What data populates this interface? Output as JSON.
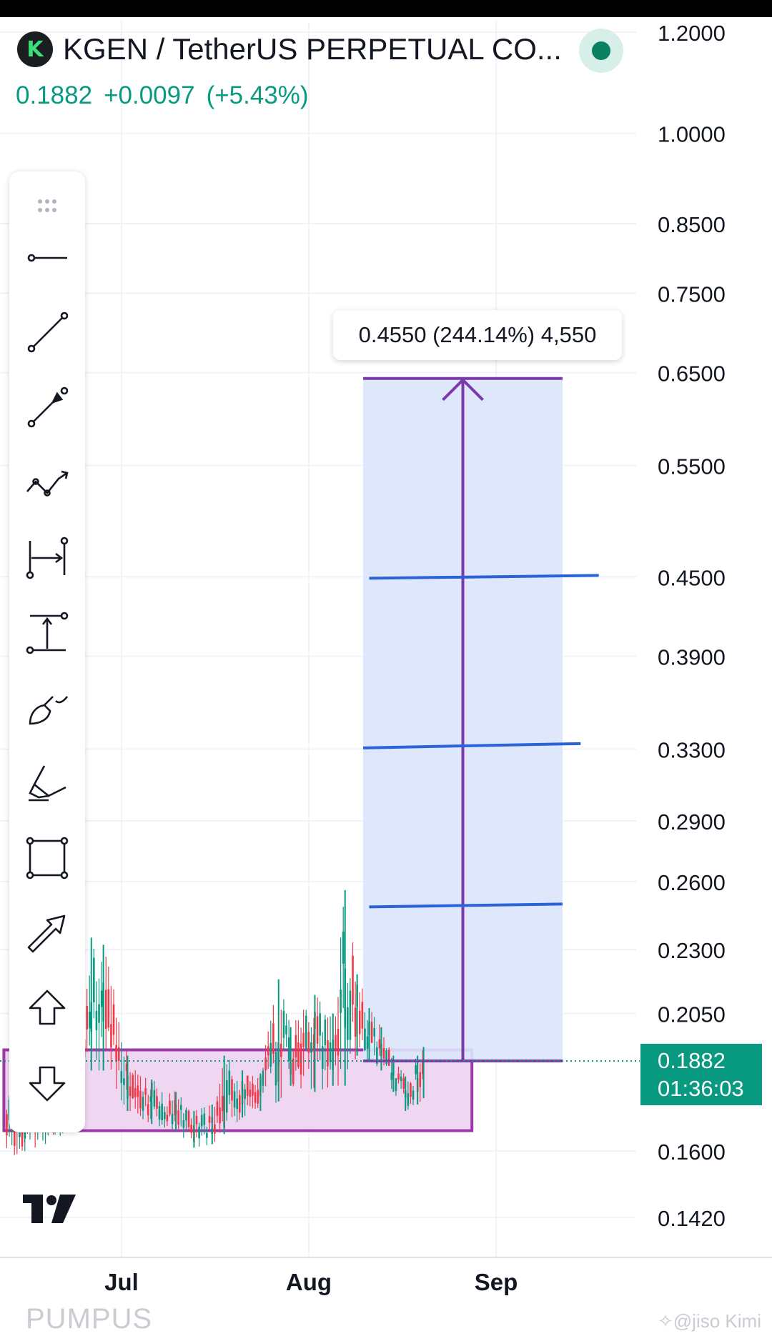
{
  "header": {
    "symbol_title": "KGEN / TetherUS PERPETUAL CO...",
    "logo_letter": "K",
    "last_price": "0.1882",
    "change": "+0.0097",
    "change_pct": "(+5.43%)"
  },
  "toolbar": {
    "tools": [
      "drag-handle-icon",
      "horizontal-ray-icon",
      "trend-line-icon",
      "arrow-line-icon",
      "path-icon",
      "date-range-icon",
      "price-range-icon",
      "brush-icon",
      "highlighter-icon",
      "rectangle-icon",
      "arrow-icon",
      "arrow-mark-up-icon",
      "arrow-mark-down-icon"
    ]
  },
  "measure": {
    "label": "0.4550 (244.14%) 4,550",
    "from_price": 0.1882,
    "to_price": 0.6432
  },
  "price_badge": {
    "price": "0.1882",
    "countdown": "01:36:03"
  },
  "footer": {
    "watermark": "PUMPUS",
    "credit": "✧@jiso Kimi"
  },
  "colors": {
    "up": "#089981",
    "down": "#f23645",
    "measure_fill": "#dbe6fb",
    "measure_line": "#7a3aa7",
    "box_fill": "#edd0ee",
    "box_stroke": "#9c3aa8",
    "hline": "#2a62d8"
  },
  "chart_data": {
    "type": "candlestick",
    "y_scale": "log",
    "y_ticks": [
      0.142,
      0.16,
      0.205,
      0.23,
      0.26,
      0.29,
      0.33,
      0.39,
      0.45,
      0.55,
      0.65,
      0.75,
      0.85,
      1.0,
      1.2
    ],
    "y_tick_labels": [
      "0.1420",
      "0.1600",
      "0.2050",
      "0.2300",
      "0.2600",
      "0.2900",
      "0.3300",
      "0.3900",
      "0.4500",
      "0.5500",
      "0.6500",
      "0.7500",
      "0.8500",
      "1.0000",
      "1.2000"
    ],
    "x_ticks": [
      {
        "label": "Jul",
        "date": "2025-07-01"
      },
      {
        "label": "Aug",
        "date": "2025-08-01"
      },
      {
        "label": "Sep",
        "date": "2025-09-01"
      }
    ],
    "x_range": [
      "2025-06-12",
      "2025-09-24"
    ],
    "grid": true,
    "drawings": {
      "horizontal_lines": [
        {
          "price": 0.45,
          "from": "2025-08-11",
          "to": "2025-09-18"
        },
        {
          "price": 0.332,
          "from": "2025-08-10",
          "to": "2025-09-15"
        },
        {
          "price": 0.249,
          "from": "2025-08-11",
          "to": "2025-09-12"
        }
      ],
      "range_box": {
        "from": "2025-06-12",
        "to": "2025-08-28",
        "top": 0.192,
        "bottom": 0.166
      },
      "price_range": {
        "from": "2025-08-10",
        "to": "2025-09-12",
        "low": 0.1882,
        "high": 0.6432
      }
    },
    "candles_approx": [
      {
        "date": "2025-06-24",
        "low": 0.17,
        "high": 0.19
      },
      {
        "date": "2025-06-26",
        "low": 0.185,
        "high": 0.235
      },
      {
        "date": "2025-06-28",
        "low": 0.185,
        "high": 0.232
      },
      {
        "date": "2025-07-02",
        "low": 0.172,
        "high": 0.19
      },
      {
        "date": "2025-07-06",
        "low": 0.168,
        "high": 0.182
      },
      {
        "date": "2025-07-10",
        "low": 0.166,
        "high": 0.178
      },
      {
        "date": "2025-07-13",
        "low": 0.161,
        "high": 0.172
      },
      {
        "date": "2025-07-16",
        "low": 0.162,
        "high": 0.174
      },
      {
        "date": "2025-07-18",
        "low": 0.165,
        "high": 0.19
      },
      {
        "date": "2025-07-21",
        "low": 0.17,
        "high": 0.185
      },
      {
        "date": "2025-07-24",
        "low": 0.172,
        "high": 0.184
      },
      {
        "date": "2025-07-27",
        "low": 0.175,
        "high": 0.218
      },
      {
        "date": "2025-07-29",
        "low": 0.18,
        "high": 0.2
      },
      {
        "date": "2025-08-02",
        "low": 0.178,
        "high": 0.212
      },
      {
        "date": "2025-08-05",
        "low": 0.18,
        "high": 0.205
      },
      {
        "date": "2025-08-07",
        "low": 0.18,
        "high": 0.256
      },
      {
        "date": "2025-08-09",
        "low": 0.19,
        "high": 0.22
      },
      {
        "date": "2025-08-11",
        "low": 0.188,
        "high": 0.207
      },
      {
        "date": "2025-08-13",
        "low": 0.185,
        "high": 0.2
      },
      {
        "date": "2025-08-15",
        "low": 0.178,
        "high": 0.19
      },
      {
        "date": "2025-08-17",
        "low": 0.172,
        "high": 0.183
      },
      {
        "date": "2025-08-19",
        "low": 0.174,
        "high": 0.19
      },
      {
        "date": "2025-08-20",
        "low": 0.176,
        "high": 0.193
      }
    ]
  }
}
